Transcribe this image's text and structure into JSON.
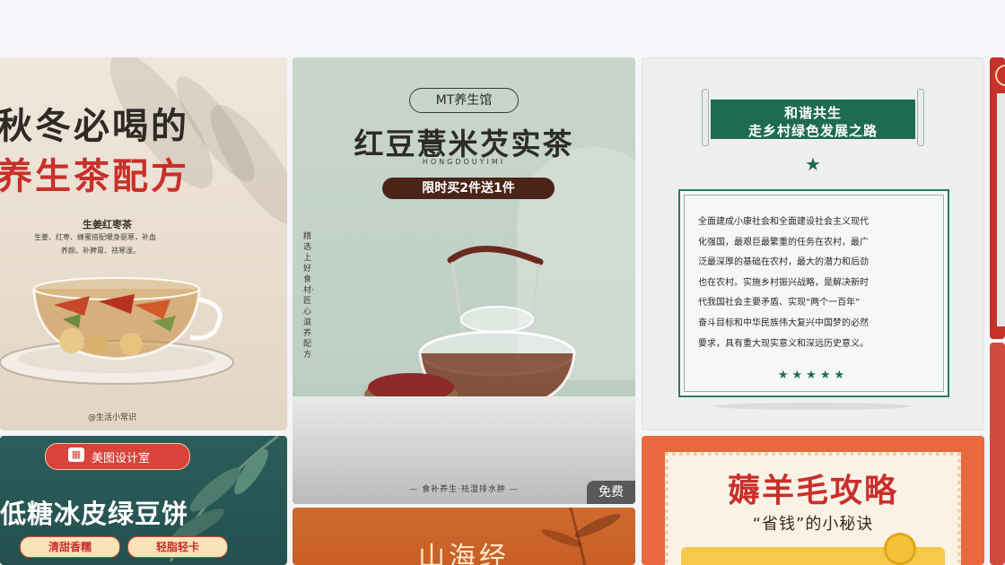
{
  "cards": {
    "c1": {
      "title_line1": "秋冬必喝的",
      "title_line2": "养生茶配方",
      "recipe_name": "生姜红枣茶",
      "recipe_line1": "生姜、红枣、蜂蜜搭配暖身驱寒，补血",
      "recipe_line2": "养颜、补脾胃、祛寒湿。",
      "credit": "@生活小常识"
    },
    "c2": {
      "brand": "MT养生馆",
      "title": "红豆薏米芡实茶",
      "pinyin": "HONGDOUYIMI",
      "promo": "限时买2件送1件",
      "side_text": "精选上好食材·匠心滋养配方",
      "footer": "— 食补养生·祛湿排水肿 —",
      "badge": "免费"
    },
    "c3": {
      "banner_line1": "和谐共生",
      "banner_line2": "走乡村绿色发展之路",
      "paragraph": [
        "全面建成小康社会和全面建设社会主义现代",
        "化强国，最艰巨最繁重的任务在农村，最广",
        "泛最深厚的基础在农村，最大的潜力和后劲",
        "也在农村。实施乡村振兴战略，是解决新时",
        "代我国社会主要矛盾、实现“两个一百年”",
        "奋斗目标和中华民族伟大复兴中国梦的必然",
        "要求，具有重大现实意义和深远历史意义。"
      ]
    },
    "c5": {
      "tag": "美图设计室",
      "title": "低糖冰皮绿豆饼",
      "chip1": "清甜香糯",
      "chip2": "轻脂轻卡"
    },
    "c6": {
      "title": "山海经"
    },
    "c7": {
      "title": "薅羊毛攻略",
      "subtitle": "“省钱”的小秘诀"
    }
  },
  "colors": {
    "page_bg": "#f4f5f8",
    "tea_red": "#c8302a",
    "tea_dark": "#2f2a26",
    "teal_banner": "#1f6b4f",
    "promo_dark": "#4a2418",
    "coupon_orange": "#e9693e",
    "coupon_red": "#c9302b"
  },
  "icons": {
    "c5_tag": "grid-app-icon",
    "c3_star": "star-icon",
    "c7_coin": "coin-icon"
  }
}
